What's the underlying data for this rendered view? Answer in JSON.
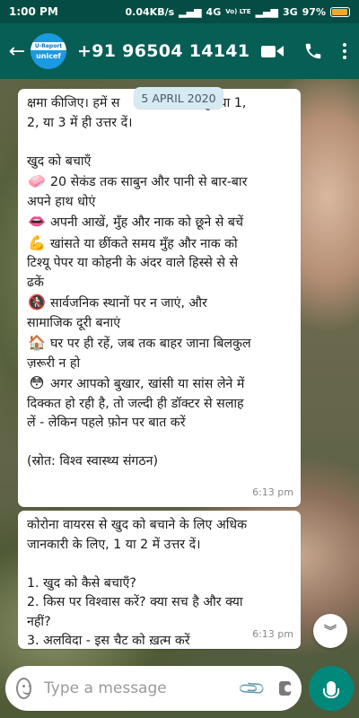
{
  "status_bar": {
    "time": "1:00 PM",
    "network_speed": "0.04KB/s",
    "network_sim1": "4G",
    "volte": "Vo) LTE",
    "network_sim2": "3G",
    "battery": "97%",
    "battery_level": 0.97
  },
  "header": {
    "contact": "+91 96504 14141",
    "avatar_top": "U-Report",
    "avatar_bottom": "unicef"
  },
  "date_chip": "5 APRIL 2020",
  "messages": [
    {
      "lines": [
        {
          "emoji": "",
          "text": "क्षमा कीजिए। हमें स",
          "tail": "कृपया 1,"
        },
        {
          "emoji": "",
          "text": "2, या 3 में ही उत्तर दें।"
        },
        {
          "gap": true
        },
        {
          "emoji": "",
          "text": "खुद को बचाएँ"
        },
        {
          "emoji": "🧼",
          "text": "20 सेकंड तक साबुन और पानी से बार-बार"
        },
        {
          "emoji": "",
          "text": "अपने हाथ धोएं"
        },
        {
          "emoji": "👄",
          "text": "अपनी आखें, मुँह और नाक को छूने से बचें"
        },
        {
          "emoji": "💪",
          "text": "खांसते या छींकते समय मुँह और नाक को"
        },
        {
          "emoji": "",
          "text": "टिश्यू पेपर या कोहनी के अंदर वाले हिस्से से से"
        },
        {
          "emoji": "",
          "text": "ढकें"
        },
        {
          "emoji": "🚷",
          "text": "सार्वजनिक स्थानों पर न जाएं, और"
        },
        {
          "emoji": "",
          "text": "सामाजिक दूरी बनाएं"
        },
        {
          "emoji": "🏠",
          "text": "घर पर ही रहें, जब तक बाहर जाना बिलकुल"
        },
        {
          "emoji": "",
          "text": "ज़रूरी न हो"
        },
        {
          "emoji": "😳",
          "text": "अगर आपको बुखार, खांसी या सांस लेने में"
        },
        {
          "emoji": "",
          "text": "दिक्कत हो रही है, तो जल्दी ही डॉक्टर से सलाह"
        },
        {
          "emoji": "",
          "text": "लें - लेकिन पहले फ़ोन पर बात करें"
        },
        {
          "gap": true
        },
        {
          "emoji": "",
          "text": "(स्रोत: विश्व स्वास्थ्य संगठन)"
        }
      ],
      "time": "6:13 pm"
    },
    {
      "lines": [
        {
          "emoji": "",
          "text": "कोरोना वायरस से खुद को बचाने के लिए अधिक"
        },
        {
          "emoji": "",
          "text": "जानकारी के लिए, 1 या 2 में उत्तर दें।"
        },
        {
          "gap": true
        },
        {
          "emoji": "",
          "text": "1.  खुद को कैसे बचाएँ?"
        },
        {
          "emoji": "",
          "text": "2.  किस पर विश्वास करें? क्या सच है और क्या"
        },
        {
          "emoji": "",
          "text": "नहीं?"
        },
        {
          "emoji": "",
          "text": "3.  अलविदा - इस चैट को ख़त्म करें"
        }
      ],
      "time": "6:13 pm"
    }
  ],
  "input": {
    "placeholder": "Type a message"
  },
  "icons": {
    "back": "back-arrow-icon",
    "video": "video-call-icon",
    "call": "phone-call-icon",
    "menu": "more-options-icon",
    "emoji": "emoji-icon",
    "attach": "attachment-icon",
    "camera": "camera-icon",
    "mic": "microphone-icon",
    "scroll": "scroll-down-icon"
  },
  "colors": {
    "header": "#075e54",
    "status_bar": "#054d44",
    "mic_button": "#00897b",
    "date_chip": "#d6eaf3"
  }
}
